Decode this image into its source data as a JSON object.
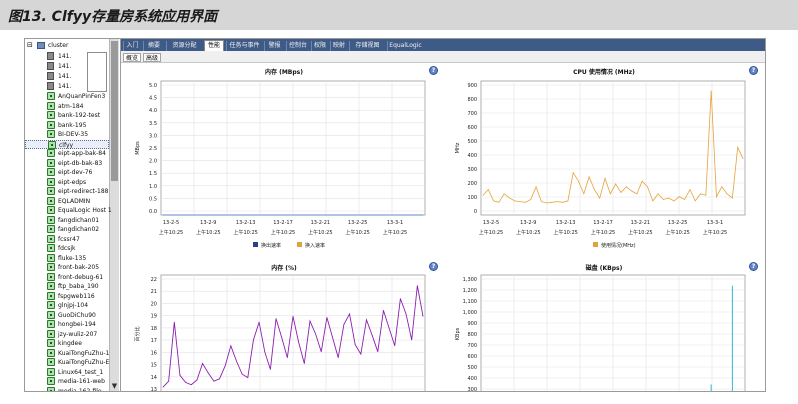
{
  "caption": "图13. Clfyy存量房系统应用界面",
  "sidebar": {
    "root_label": "cluster",
    "hosts": [
      "141.",
      "141.",
      "141.",
      "141."
    ],
    "vms": [
      "AnQuanPinFen3",
      "atm-184",
      "bank-192-test",
      "bank-195",
      "BI-DEV-35",
      "clfyy",
      "eipt-app-bak-84",
      "eipt-db-bak-83",
      "eipt-dev-76",
      "eipt-edps",
      "eipt-redirect-188",
      "EQLADMIN",
      "EqualLogic Host 1",
      "fangdichan01",
      "fangdichan02",
      "fcssr47",
      "fdcsjk",
      "fluke-135",
      "front-bak-205",
      "front-debug-61",
      "ftp_baba_190",
      "fspgweb116",
      "glnjpj-104",
      "GuoDiChu90",
      "hongbei-194",
      "jzy-wuliz-207",
      "kingdee",
      "KuaiTongFuZhu-1",
      "KuaiTongFuZhu-E",
      "Linux64_test_1",
      "media-161-web",
      "media-162-file"
    ],
    "selected_index": 5
  },
  "tabs": {
    "items": [
      "入门",
      "摘要",
      "资源分配",
      "性能",
      "任务与事件",
      "警报",
      "控制台",
      "权限",
      "映射",
      "存储视图",
      "EqualLogic"
    ],
    "active_index": 3
  },
  "subtabs": {
    "items": [
      "概览",
      "高级"
    ],
    "active_index": 0
  },
  "help_glyph": "?",
  "charts": [
    {
      "id": "memory-rate",
      "title": "内存 (MBps)",
      "ylabel": "MBps",
      "yticks": [
        "5.0",
        "4.5",
        "4.0",
        "3.5",
        "3.0",
        "2.5",
        "2.0",
        "1.5",
        "1.0",
        "0.5",
        "0.0"
      ],
      "xticks": [
        "13-2-5",
        "13-2-9",
        "13-2-13",
        "13-2-17",
        "13-2-21",
        "13-2-25",
        "13-3-1"
      ],
      "xticks_sub": [
        "上午10:25",
        "上午10:25",
        "上午10:25",
        "上午10:25",
        "上午10:25",
        "上午10:25",
        "上午10:25"
      ],
      "legend": [
        {
          "label": "换出速率",
          "color": "#2b3f8f"
        },
        {
          "label": "换入速率",
          "color": "#e0a23a"
        }
      ],
      "series_color": "#5c86d0"
    },
    {
      "id": "cpu-usage",
      "title": "CPU 使用情况 (MHz)",
      "ylabel": "MHz",
      "yticks": [
        "900",
        "800",
        "700",
        "600",
        "500",
        "400",
        "300",
        "200",
        "100",
        "0"
      ],
      "xticks": [
        "13-2-5",
        "13-2-9",
        "13-2-13",
        "13-2-17",
        "13-2-21",
        "13-2-25",
        "13-3-1"
      ],
      "xticks_sub": [
        "上午10:25",
        "上午10:25",
        "上午10:25",
        "上午10:25",
        "上午10:25",
        "上午10:25",
        "上午10:25"
      ],
      "legend": [
        {
          "label": "使用情况(MHz)",
          "color": "#e0a23a"
        }
      ],
      "series_color": "#e3a43a"
    },
    {
      "id": "memory-pct",
      "title": "内存 (%)",
      "ylabel": "百分比",
      "yticks": [
        "22",
        "21",
        "20",
        "19",
        "18",
        "17",
        "16",
        "15",
        "14",
        "13"
      ],
      "series_color": "#8b1fb0"
    },
    {
      "id": "disk-kbps",
      "title": "磁盘 (KBps)",
      "ylabel": "KBps",
      "yticks": [
        "1,300",
        "1,200",
        "1,100",
        "1,000",
        "900",
        "800",
        "700",
        "600",
        "500",
        "400",
        "300"
      ],
      "series_color": "#33b7d8"
    }
  ],
  "chart_data": [
    {
      "type": "line",
      "title": "内存 (MBps)",
      "ylabel": "MBps",
      "ylim": [
        0,
        5.0
      ],
      "x": [
        "13-2-5",
        "13-2-9",
        "13-2-13",
        "13-2-17",
        "13-2-21",
        "13-2-25",
        "13-3-1"
      ],
      "series": [
        {
          "name": "换出速率",
          "values": [
            0,
            0,
            0,
            0,
            0,
            0,
            0
          ]
        },
        {
          "name": "换入速率",
          "values": [
            0,
            0,
            0,
            0,
            0,
            0,
            0
          ]
        }
      ]
    },
    {
      "type": "line",
      "title": "CPU 使用情况 (MHz)",
      "ylabel": "MHz",
      "ylim": [
        0,
        950
      ],
      "x": [
        "13-2-5",
        "13-2-9",
        "13-2-13",
        "13-2-17",
        "13-2-21",
        "13-2-25",
        "13-3-1"
      ],
      "series": [
        {
          "name": "使用情况(MHz)",
          "values": [
            140,
            180,
            100,
            90,
            150,
            120,
            100,
            95,
            90,
            110,
            200,
            95,
            85,
            90,
            95,
            90,
            100,
            300,
            240,
            150,
            270,
            180,
            120,
            260,
            150,
            220,
            160,
            200,
            170,
            150,
            240,
            200,
            100,
            150,
            110,
            120,
            100,
            130,
            110,
            180,
            100,
            150,
            140,
            880,
            130,
            200,
            150,
            120,
            480,
            400
          ]
        }
      ]
    },
    {
      "type": "line",
      "title": "内存 (%)",
      "ylabel": "百分比",
      "ylim": [
        12.5,
        22.5
      ],
      "series": [
        {
          "values": [
            13,
            13.5,
            18.5,
            14,
            13.4,
            13.2,
            13.6,
            15,
            14.2,
            13.5,
            13.7,
            14.8,
            16.5,
            15.2,
            14.1,
            13.8,
            17,
            18.5,
            16,
            14.5,
            18.8,
            17.2,
            15.5,
            19,
            16.8,
            15,
            18.6,
            17.5,
            16,
            18.9,
            17.2,
            15.5,
            18.3,
            19.2,
            16.6,
            15.8,
            18.7,
            17.4,
            16,
            19.5,
            18,
            16.5,
            20.5,
            19.2,
            17,
            21.6,
            19
          ]
        }
      ]
    },
    {
      "type": "line",
      "title": "磁盘 (KBps)",
      "ylabel": "KBps",
      "ylim": [
        250,
        1350
      ],
      "series": [
        {
          "values": [
            0,
            0,
            0,
            0,
            0,
            0,
            0,
            0,
            0,
            0,
            0,
            0,
            0,
            0,
            0,
            0,
            0,
            0,
            0,
            0,
            0,
            0,
            0,
            0,
            0,
            0,
            0,
            0,
            0,
            0,
            0,
            0,
            0,
            0,
            0,
            0,
            0,
            0,
            0,
            0,
            0,
            0,
            0,
            330,
            0,
            0,
            0,
            1250,
            0,
            0
          ]
        }
      ]
    }
  ]
}
